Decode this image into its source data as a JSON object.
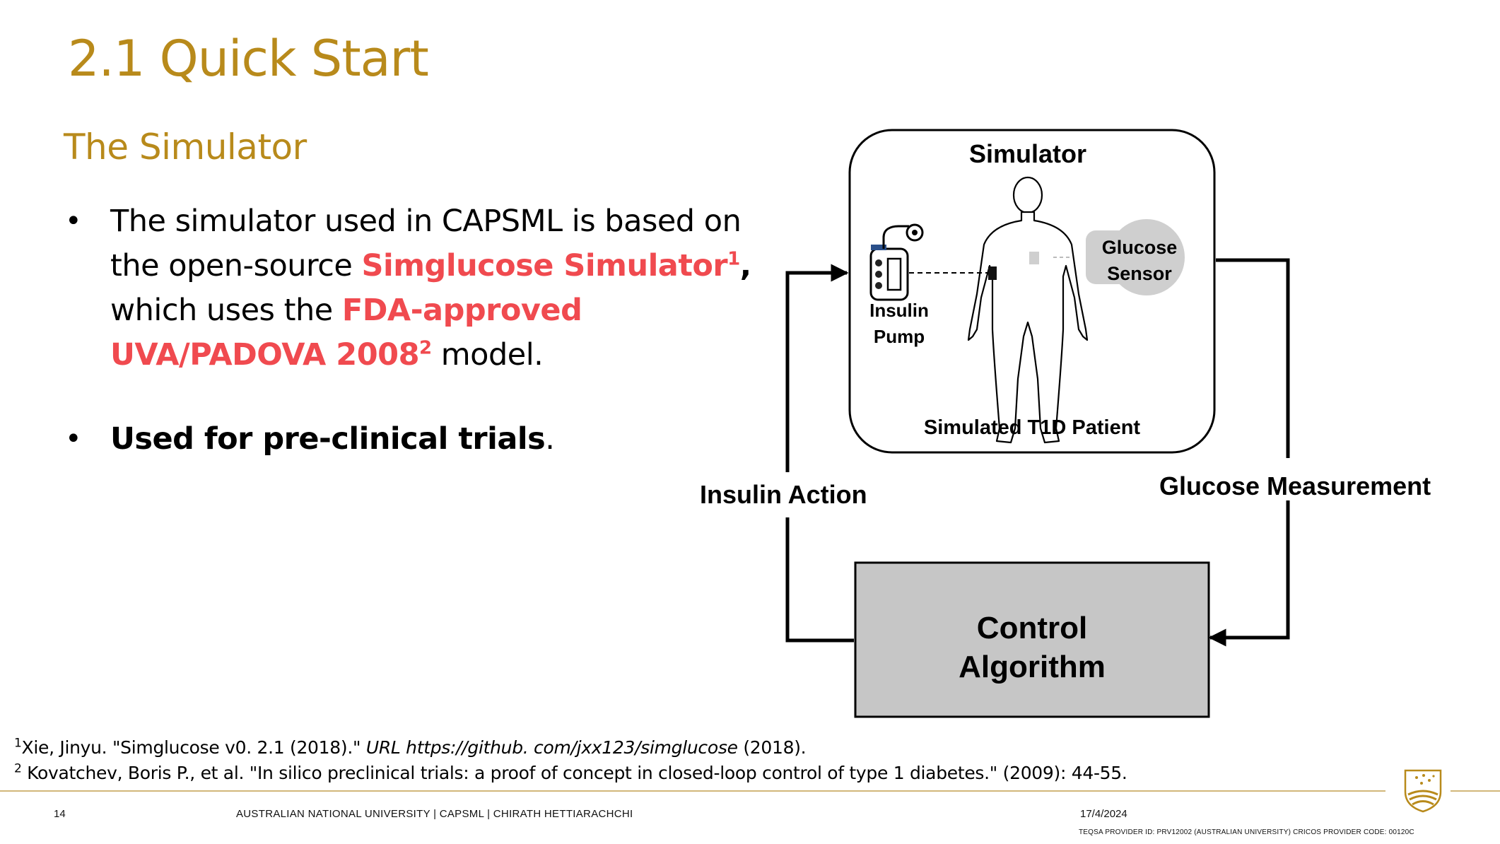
{
  "slide": {
    "title": "2.1 Quick Start",
    "subtitle": "The Simulator"
  },
  "bullets": [
    {
      "line1": "The simulator used in CAPSML is based on",
      "line2_pre": "the open-source ",
      "line2_hl": "Simglucose Simulator",
      "line2_sup": "1",
      "line2_post": ",",
      "line3_pre": "which uses the ",
      "line3_hl": "FDA-approved",
      "line4_hl": "UVA/PADOVA 2008",
      "line4_sup": "2",
      "line4_post": " model."
    },
    {
      "bold": "Used for pre-clinical trials",
      "post": "."
    }
  ],
  "diagram": {
    "simulator_label": "Simulator",
    "pump_label_1": "Insulin",
    "pump_label_2": "Pump",
    "sensor_label_1": "Glucose",
    "sensor_label_2": "Sensor",
    "patient_label": "Simulated T1D Patient",
    "insulin_action": "Insulin Action",
    "glucose_measurement": "Glucose Measurement",
    "control_1": "Control",
    "control_2": "Algorithm"
  },
  "footnotes": [
    {
      "sup": "1",
      "pre": "Xie, Jinyu. \"Simglucose v0. 2.1 (2018).\" ",
      "italic": "URL https://github. com/jxx123/simglucose",
      "post": " (2018)."
    },
    {
      "sup": "2",
      "text": " Kovatchev, Boris P., et al. \"In silico preclinical trials: a proof of concept in closed-loop control of type 1 diabetes.\" (2009): 44-55."
    }
  ],
  "footer": {
    "page": "14",
    "center": "AUSTRALIAN NATIONAL UNIVERSITY |   CAPSML   |  CHIRATH HETTIARACHCHI",
    "date": "17/4/2024",
    "teqsa": "TEQSA PROVIDER ID: PRV12002 (AUSTRALIAN UNIVERSITY) CRICOS PROVIDER CODE: 00120C"
  },
  "colors": {
    "accent_gold": "#b88a1b",
    "highlight_red": "#f04a4f",
    "control_box": "#c6c6c6"
  },
  "icons": [
    "body-silhouette-icon",
    "insulin-pump-icon",
    "glucose-sensor-icon",
    "anu-crest-icon"
  ]
}
